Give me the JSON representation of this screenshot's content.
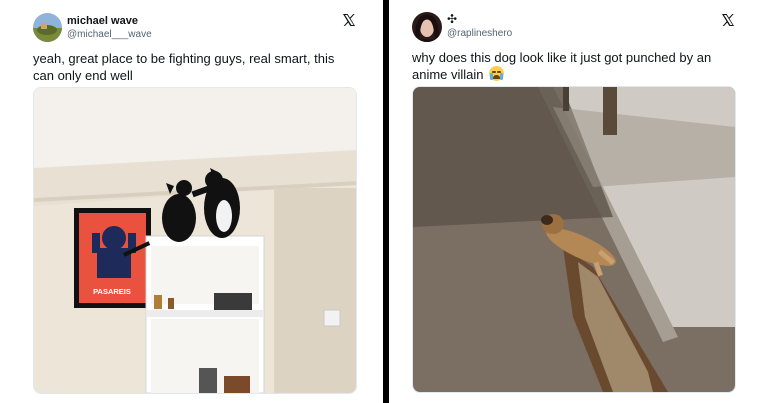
{
  "tweets": [
    {
      "name": "michael wave",
      "handle": "@michael___wave",
      "text": "yeah, great place to be fighting guys, real smart, this can only end well",
      "poster_text": "PASAREIS",
      "icons": {
        "avatar": "profile-photo",
        "logo": "x-logo",
        "media": "photo-two-cats-on-shelf"
      }
    },
    {
      "name": "",
      "name_symbol": "✣",
      "handle": "@raplineshero",
      "text": "why does this dog look like it just got punched by an anime villain",
      "emoji": "crying-face-emoji",
      "icons": {
        "avatar": "profile-photo",
        "logo": "x-logo",
        "media": "photo-dog-in-dirt-ditch"
      }
    }
  ],
  "colors": {
    "text": "#0f1419",
    "secondary": "#536471",
    "divider": "#000000"
  }
}
